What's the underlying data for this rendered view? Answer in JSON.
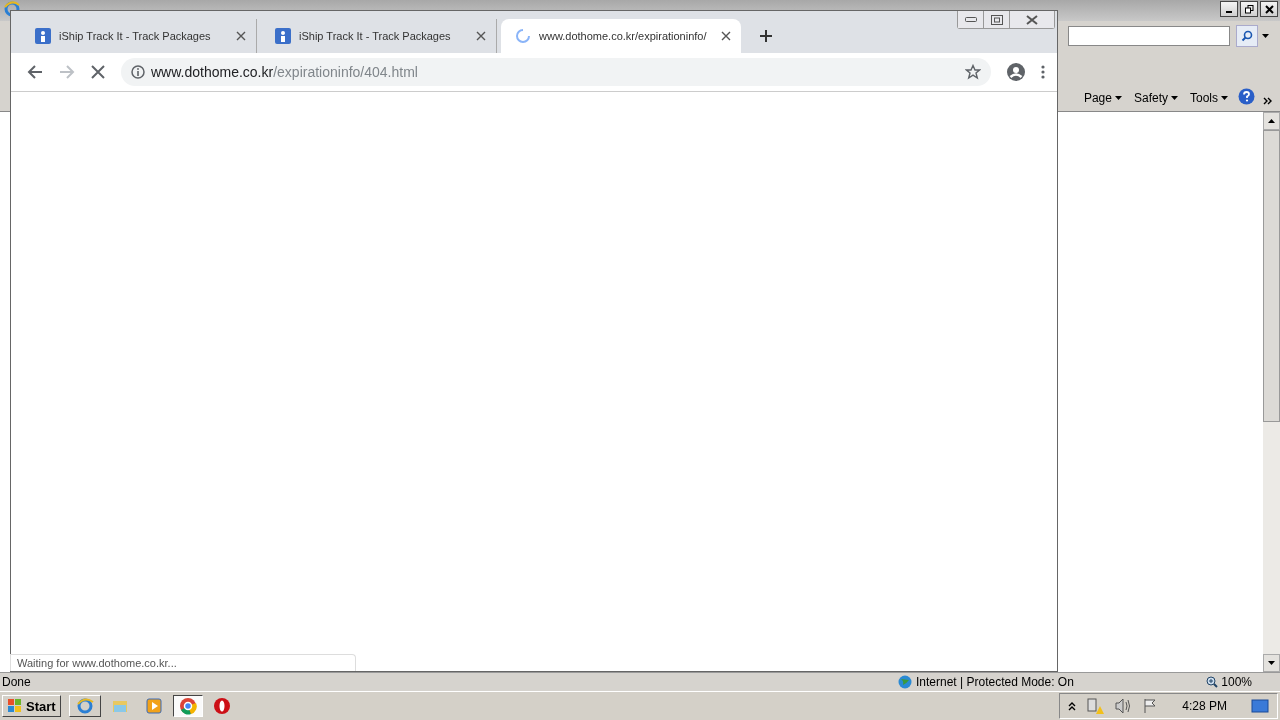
{
  "ie_window": {
    "command_bar": [
      {
        "label": "Page"
      },
      {
        "label": "Safety"
      },
      {
        "label": "Tools"
      }
    ],
    "status_bar": {
      "status": "Done",
      "zone": "Internet | Protected Mode: On",
      "zoom": "100%"
    }
  },
  "chrome_window": {
    "tabs": [
      {
        "title": "iShip Track It - Track Packages",
        "selected": false,
        "loading": false
      },
      {
        "title": "iShip Track It - Track Packages",
        "selected": false,
        "loading": false
      },
      {
        "title": "www.dothome.co.kr/expirationinfo/",
        "selected": true,
        "loading": true
      }
    ],
    "forward_enabled": false,
    "url_host": "www.dothome.co.kr",
    "url_path": "/expirationinfo/404.html",
    "status_bubble": "Waiting for www.dothome.co.kr..."
  },
  "taskbar": {
    "start": "Start",
    "apps": [
      {
        "kind": "ie",
        "selected": false
      },
      {
        "kind": "folder",
        "selected": false
      },
      {
        "kind": "media",
        "selected": false
      },
      {
        "kind": "chrome",
        "selected": true
      },
      {
        "kind": "opera",
        "selected": false
      }
    ],
    "clock": "4:28 PM"
  }
}
